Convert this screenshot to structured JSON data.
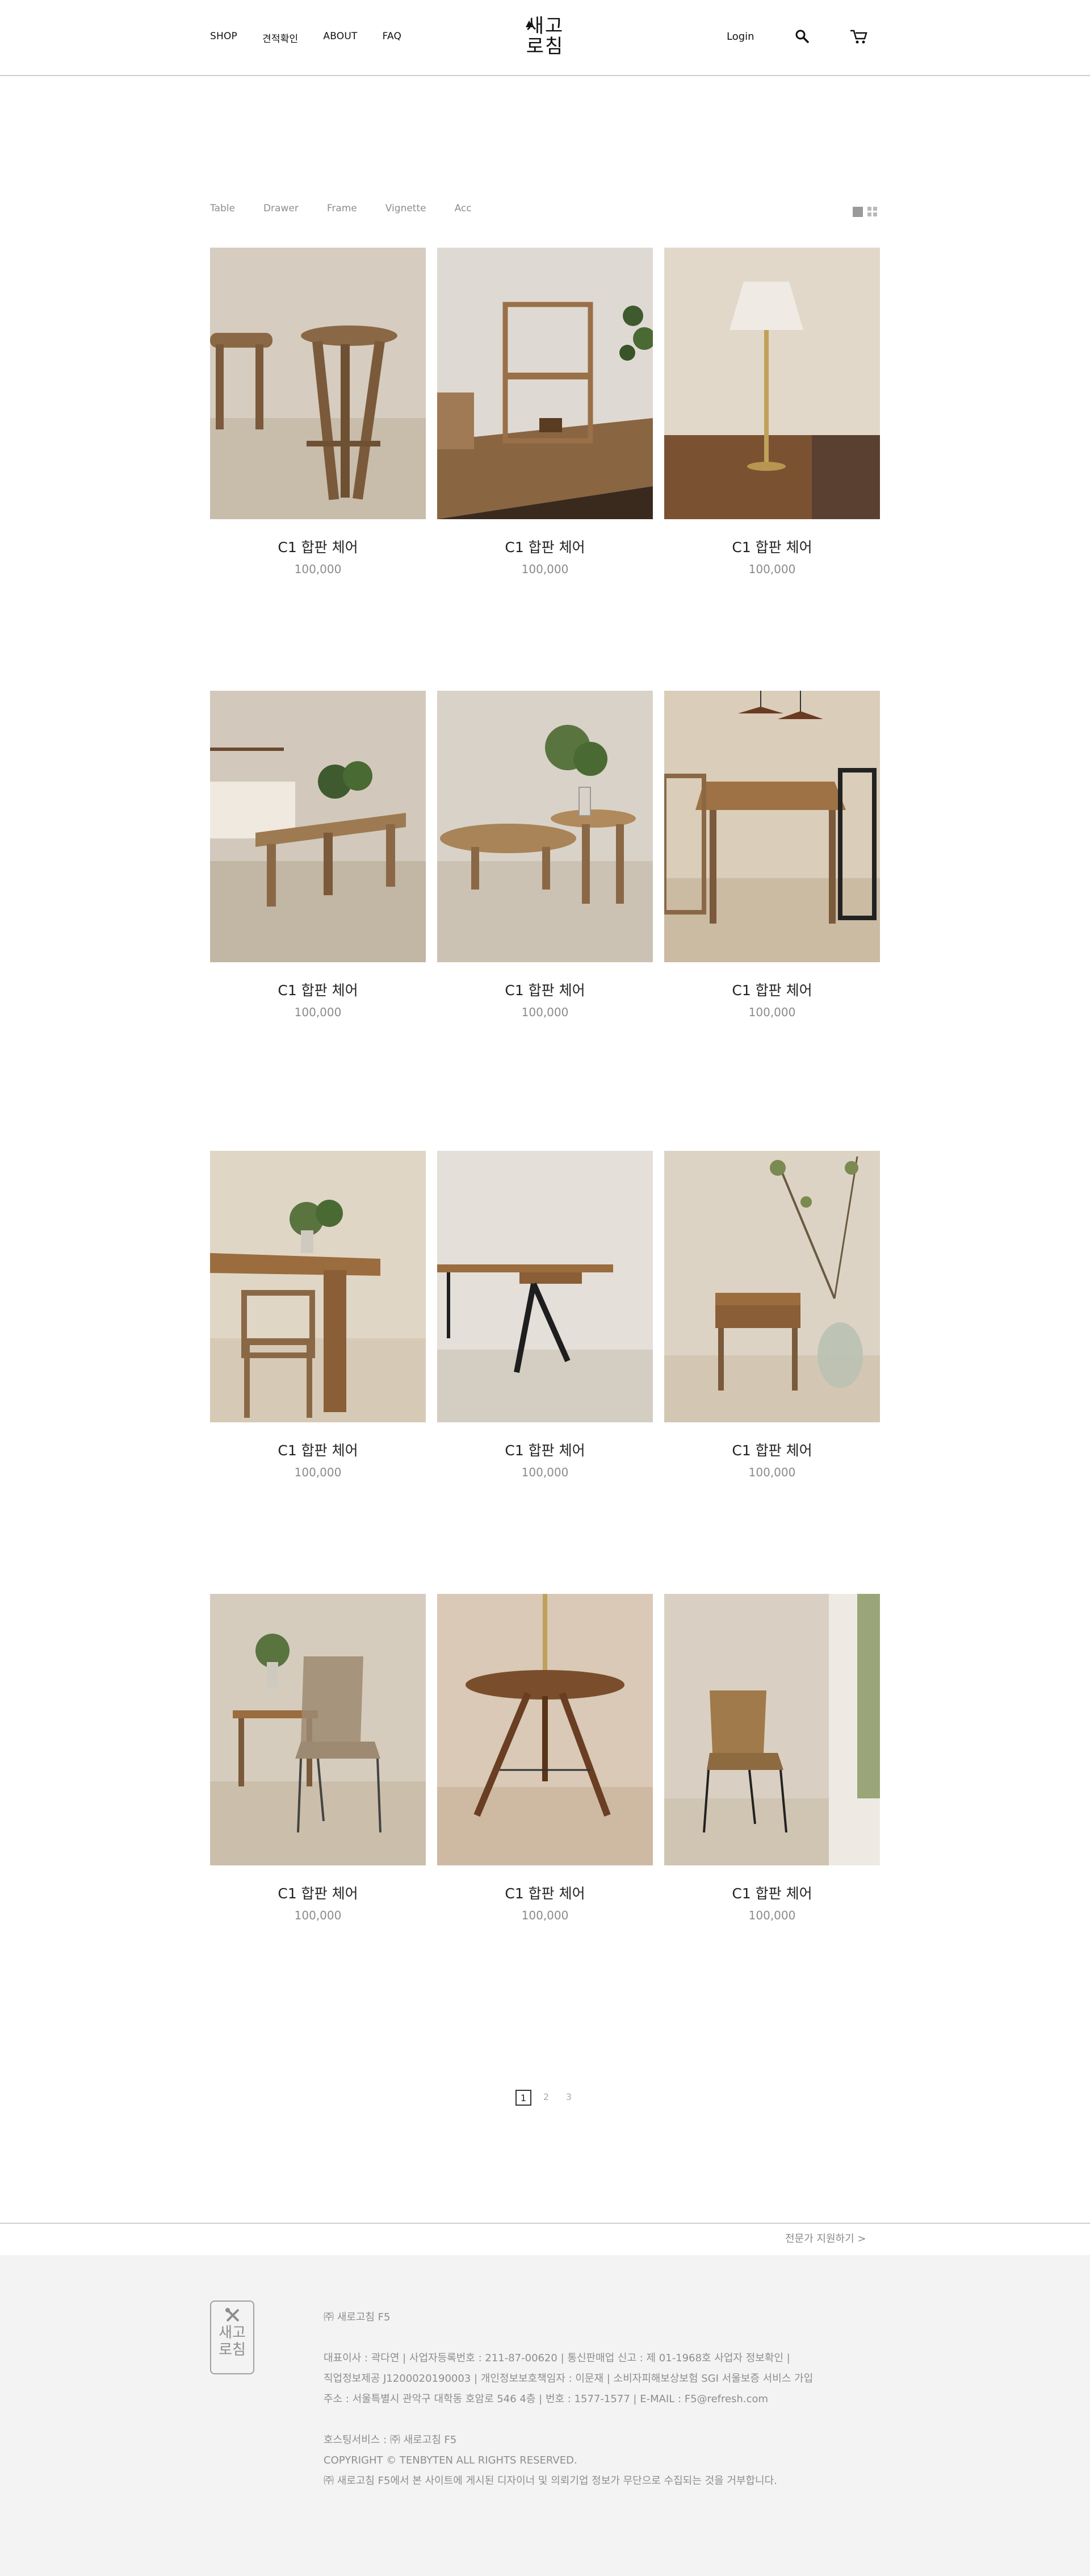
{
  "header": {
    "nav_left": [
      "SHOP",
      "견적확인",
      "ABOUT",
      "FAQ"
    ],
    "logo_line1": "새고",
    "logo_line2": "로침",
    "login": "Login",
    "search_icon": "search-icon",
    "cart_icon": "cart-icon"
  },
  "filters": [
    "Table",
    "Drawer",
    "Frame",
    "Vignette",
    "Acc"
  ],
  "products": [
    {
      "name": "C1 합판 체어",
      "price": "100,000"
    },
    {
      "name": "C1 합판 체어",
      "price": "100,000"
    },
    {
      "name": "C1 합판 체어",
      "price": "100,000"
    },
    {
      "name": "C1 합판 체어",
      "price": "100,000"
    },
    {
      "name": "C1 합판 체어",
      "price": "100,000"
    },
    {
      "name": "C1 합판 체어",
      "price": "100,000"
    },
    {
      "name": "C1 합판 체어",
      "price": "100,000"
    },
    {
      "name": "C1 합판 체어",
      "price": "100,000"
    },
    {
      "name": "C1 합판 체어",
      "price": "100,000"
    },
    {
      "name": "C1 합판 체어",
      "price": "100,000"
    },
    {
      "name": "C1 합판 체어",
      "price": "100,000"
    },
    {
      "name": "C1 합판 체어",
      "price": "100,000"
    }
  ],
  "pagination": [
    "1",
    "2",
    "3"
  ],
  "footer": {
    "expert_link": "전문가 지원하기  >",
    "logo_line1": "새고",
    "logo_line2": "로침",
    "company": "㈜ 새로고침 F5",
    "info1": "대표이사 : 곽다연 | 사업자등록번호 : 211-87-00620 | 통신판매업 신고 : 제 01-1968호 사업자 정보확인 |",
    "info2": "직업정보제공 J1200020190003 | 개인정보보호책임자 : 이문재 | 소비자피해보상보험 SGI 서울보증 서비스 가입",
    "info3": "주소 : 서울특별시 관악구 대학동 호암로 546 4층 | 번호 : 1577-1577 | E-MAIL : F5@refresh.com",
    "hosting": "호스팅서비스 : ㈜ 새로고침 F5",
    "copyright": "COPYRIGHT © TENBYTEN ALL RIGHTS RESERVED.",
    "notice": "㈜ 새로고침 F5에서 본 사이트에 게시된 디자이너 및 의뢰기업 정보가 무단으로 수집되는 것을 거부합니다."
  }
}
